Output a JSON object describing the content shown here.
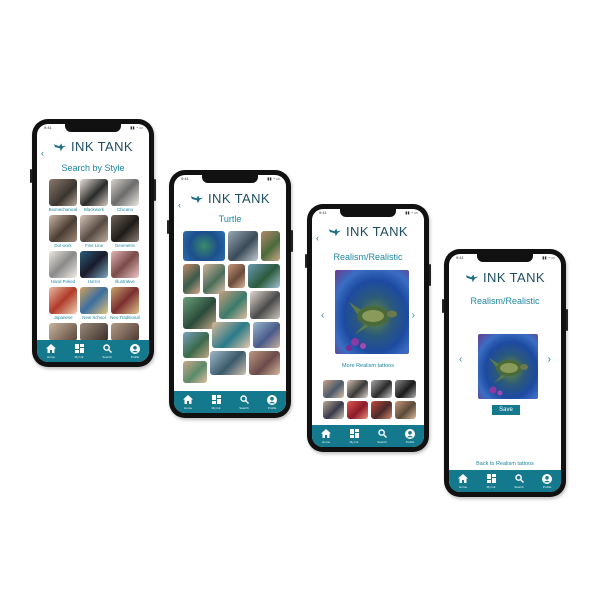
{
  "app": {
    "brand": "INK TANK",
    "time": "9:41"
  },
  "nav": [
    {
      "label": "Home",
      "icon": "home-icon"
    },
    {
      "label": "My Ink",
      "icon": "grid-icon"
    },
    {
      "label": "Search",
      "icon": "search-icon"
    },
    {
      "label": "Profile",
      "icon": "profile-icon"
    }
  ],
  "screen1": {
    "title": "Search by Style",
    "styles": [
      "Biomechanical",
      "Blackwork",
      "Chicano",
      "Dot work",
      "Fine Line",
      "Geometric",
      "Hand Poked",
      "Horror",
      "Illustrative",
      "Japanese",
      "New School",
      "Neo Traditional"
    ]
  },
  "screen2": {
    "title": "Turtle"
  },
  "screen3": {
    "title": "Realism/Realistic",
    "more_link": "More Realism tattoos"
  },
  "screen4": {
    "title": "Realism/Realistic",
    "save_label": "Save",
    "back_link": "Back to Realism tattoos"
  },
  "colors": {
    "accent": "#15798e",
    "title_text": "#1f87a0",
    "brand_text": "#1f4e61",
    "phone_frame": "#111111"
  }
}
